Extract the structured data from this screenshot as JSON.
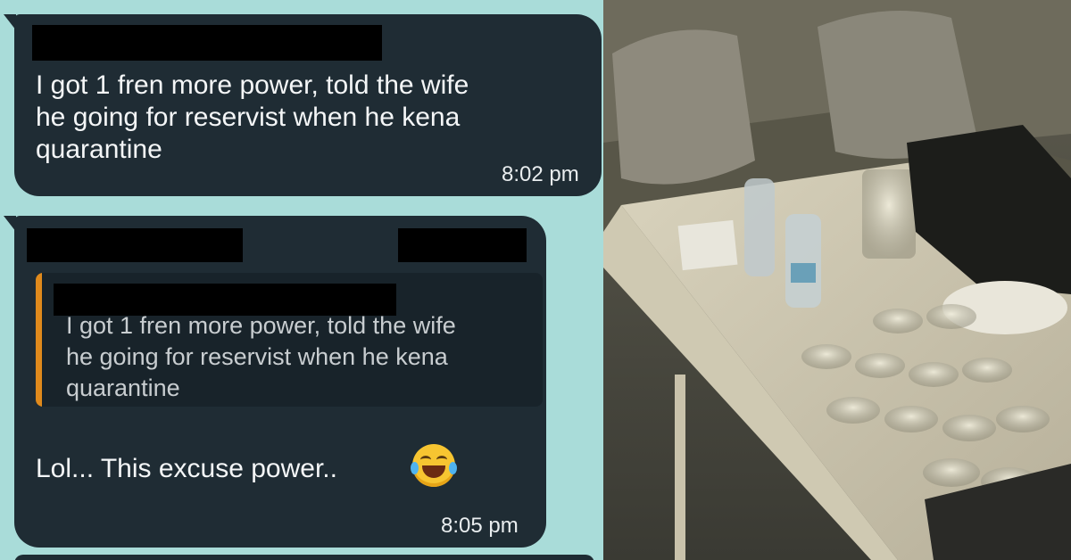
{
  "chat": {
    "message1": {
      "text": "I got 1 fren more power, told the wife\nhe going for reservist when he kena\nquarantine",
      "time": "8:02 pm"
    },
    "message2": {
      "quoted_text": "I got 1 fren more power, told the wife\nhe going for reservist when he kena\nquarantine",
      "text": "Lol... This excuse power..",
      "time": "8:05 pm",
      "emoji": "face-with-tears-of-joy-icon"
    }
  },
  "colors": {
    "chat_background": "#a9dcd9",
    "bubble": "#1f2c34",
    "quote_accent": "#e08a1c",
    "redaction": "#000000"
  },
  "photo": {
    "subject": "room-with-table-glasses-bottles"
  }
}
